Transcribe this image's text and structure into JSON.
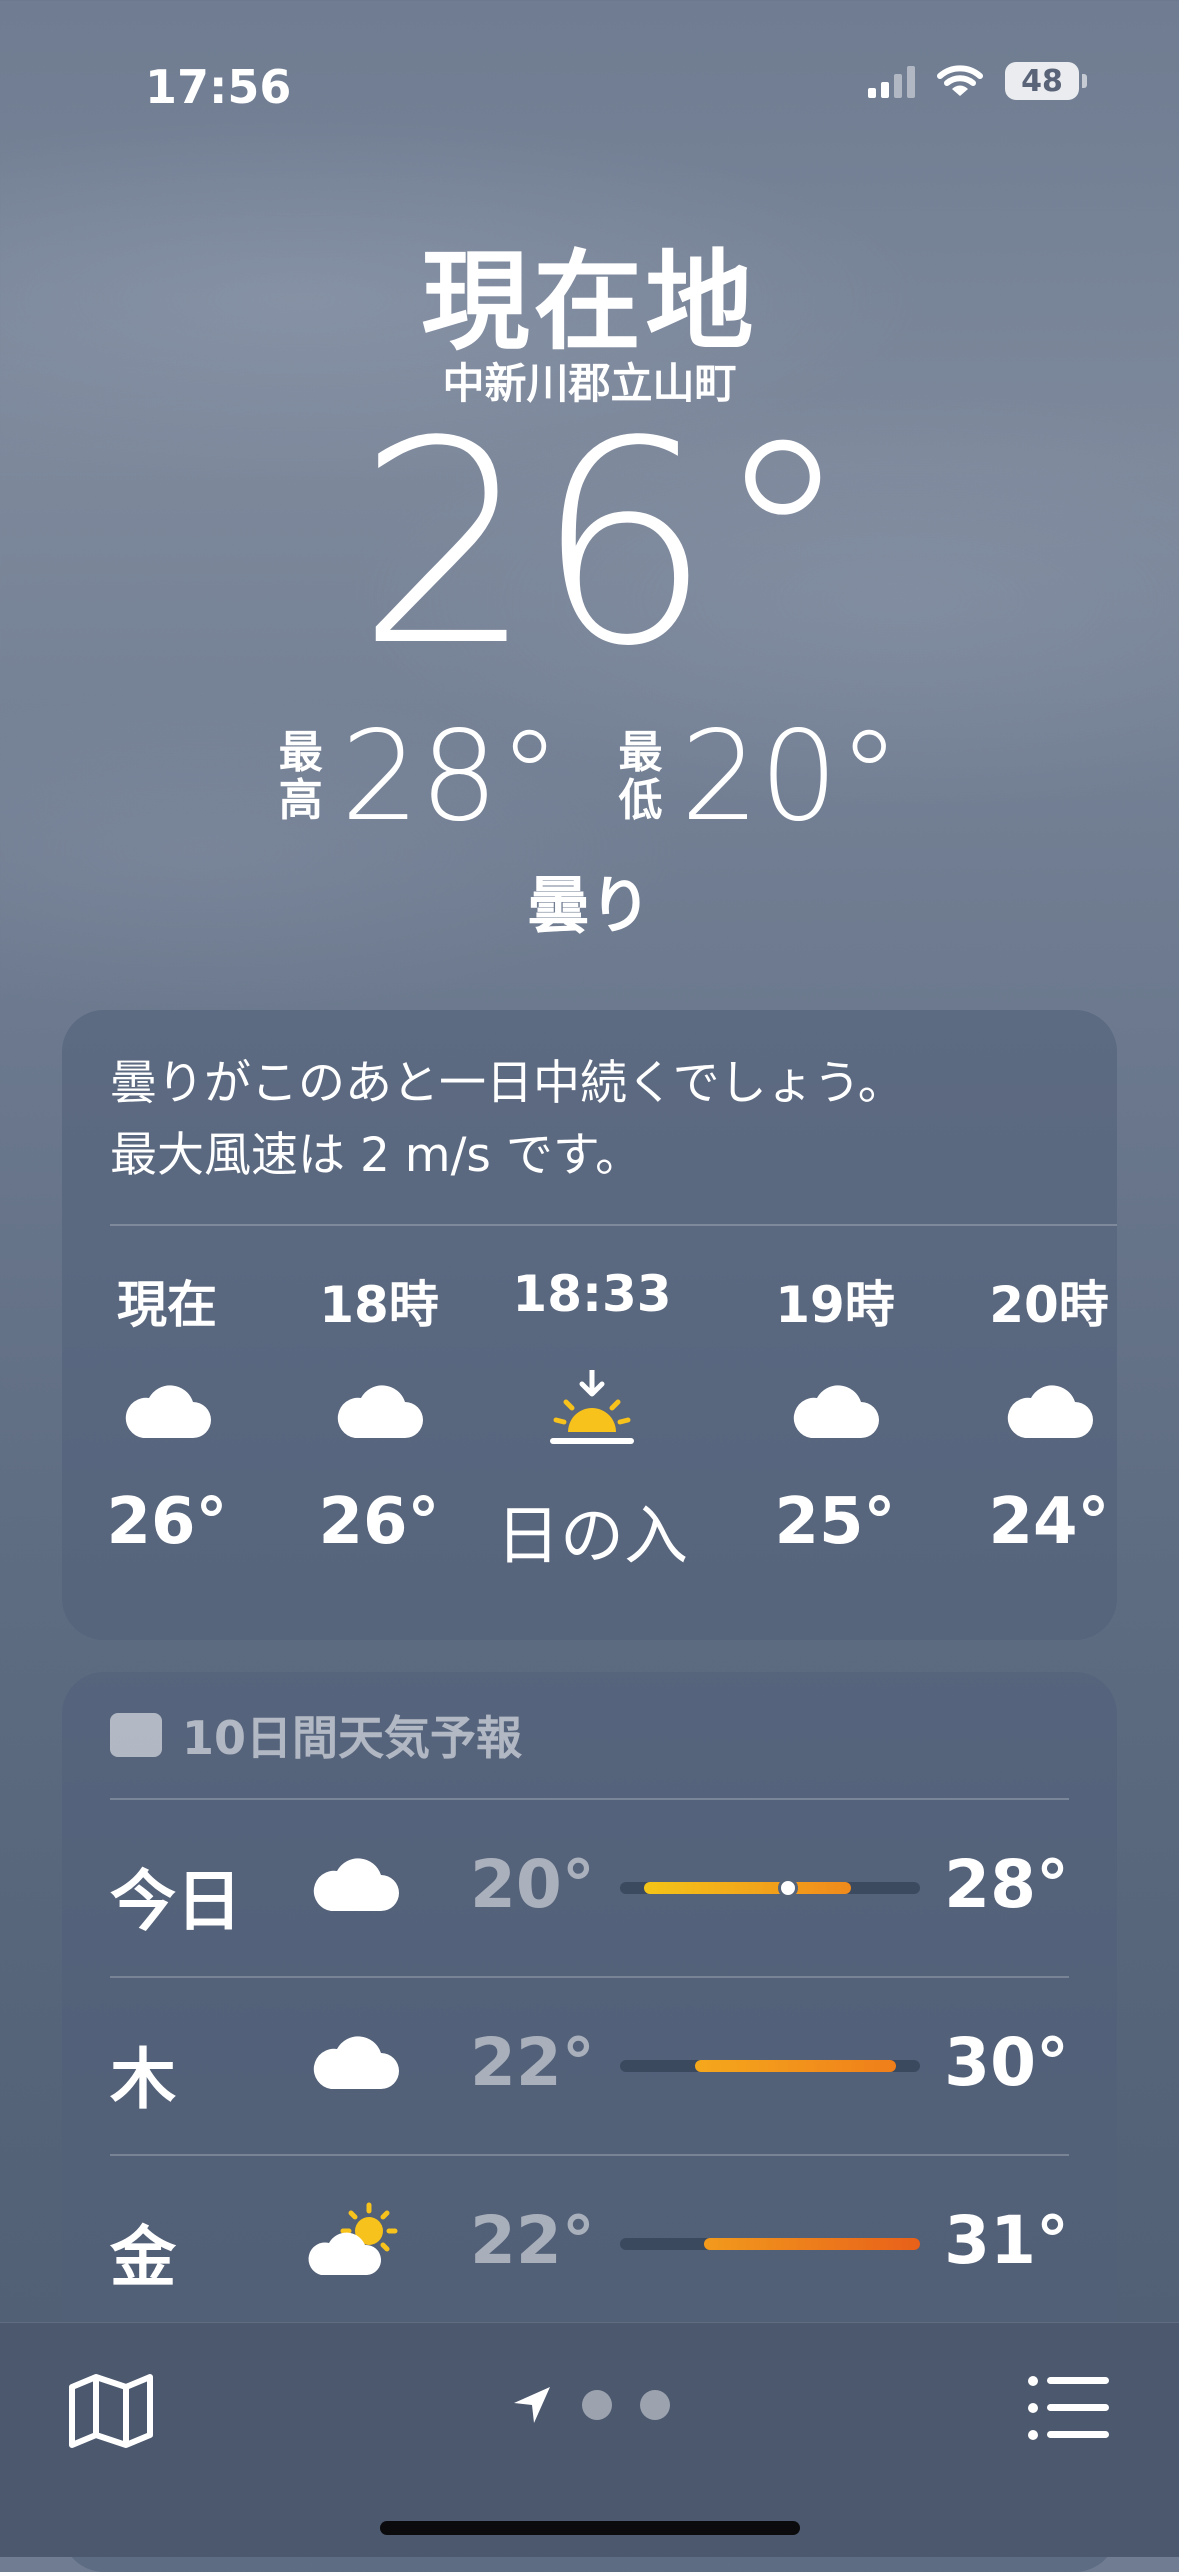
{
  "status_bar": {
    "time": "17:56",
    "battery": "48"
  },
  "location": {
    "title": "現在地",
    "subtitle": "中新川郡立山町"
  },
  "current": {
    "temp": "26°",
    "high_label": "最高",
    "high": "28°",
    "low_label": "最低",
    "low": "20°",
    "condition": "曇り"
  },
  "hourly_card": {
    "summary_line1": "曇りがこのあと一日中続くでしょう。",
    "summary_line2": "最大風速は 2 m/s です。",
    "hours": [
      {
        "time": "現在",
        "icon": "cloud-icon",
        "value": "26°"
      },
      {
        "time": "18時",
        "icon": "cloud-icon",
        "value": "26°"
      },
      {
        "time": "18:33",
        "icon": "sunset-icon",
        "value": "日の入"
      },
      {
        "time": "19時",
        "icon": "cloud-icon",
        "value": "25°"
      },
      {
        "time": "20時",
        "icon": "cloud-icon",
        "value": "24°"
      }
    ]
  },
  "forecast": {
    "title": "10日間天気予報",
    "days": [
      {
        "day": "今日",
        "icon": "cloud-icon",
        "low": "20°",
        "high": "28°",
        "range": [
          0.08,
          0.77
        ],
        "current_dot": 0.56,
        "gradient": [
          "#f5c518",
          "#f08a1c"
        ]
      },
      {
        "day": "木",
        "icon": "cloud-icon",
        "low": "22°",
        "high": "30°",
        "range": [
          0.25,
          0.92
        ],
        "gradient": [
          "#f5a81c",
          "#ef7e1a"
        ]
      },
      {
        "day": "金",
        "icon": "partly-sunny-icon",
        "low": "22°",
        "high": "31°",
        "range": [
          0.28,
          1.0
        ],
        "gradient": [
          "#f29a1c",
          "#e8601a"
        ]
      }
    ]
  },
  "colors": {
    "sun_yellow": "#f7c21b"
  }
}
